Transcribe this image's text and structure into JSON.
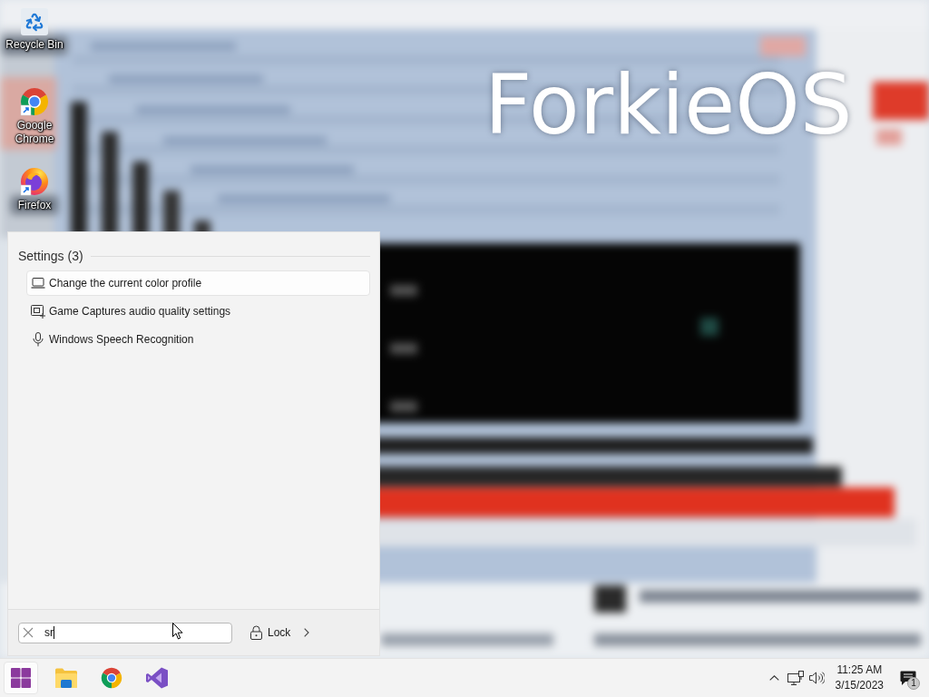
{
  "desktop": {
    "wallpaper_text": "ForkieOS",
    "icons": [
      {
        "label": "Recycle Bin"
      },
      {
        "label": "Google Chrome"
      },
      {
        "label": "Firefox"
      }
    ]
  },
  "start_menu": {
    "section_title": "Settings (3)",
    "results": [
      {
        "label": "Change the current color profile",
        "selected": true
      },
      {
        "label": "Game Captures audio quality settings",
        "selected": false
      },
      {
        "label": "Windows Speech Recognition",
        "selected": false
      }
    ],
    "search": {
      "value": "sr"
    },
    "lock_button": {
      "label": "Lock"
    }
  },
  "taskbar": {
    "start_button": {
      "active": true
    },
    "clock": {
      "time": "11:25 AM",
      "date": "3/15/2023"
    },
    "notifications": {
      "count": "1"
    }
  }
}
